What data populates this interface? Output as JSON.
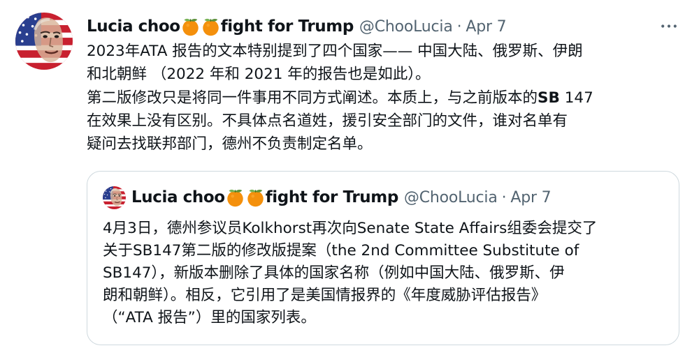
{
  "tweet": {
    "author_name_pre": "Lucia choo",
    "author_name_post": "fight for Trump",
    "handle": "@ChooLucia",
    "separator": "·",
    "date": "Apr 7",
    "body_lines": [
      "2023年ATA 报告的文本特别提到了四个国家—— 中国大陆、俄罗斯、伊朗",
      "和北朝鲜 （2022 年和 2021 年的报告也是如此）。",
      "第二版修改只是将同一件事用不同方式阐述。本质上，与之前版本的",
      "在效果上没有区别。不具体点名道姓，援引安全部门的文件，谁对名单有",
      "疑问去找联邦部门，德州不负责制定名单。"
    ],
    "body_bold": "SB",
    "body_line3_tail": " 147"
  },
  "quoted_tweet": {
    "author_name_pre": "Lucia choo",
    "author_name_post": "fight for Trump",
    "handle": "@ChooLucia",
    "separator": "·",
    "date": "Apr 7",
    "body_lines": [
      "4月3日，德州参议员Kolkhorst再次向Senate State Affairs组委会提交了",
      "关于SB147第二版的修改版提案（the 2nd Committee Substitute of",
      "SB147），新版本删除了具体的国家名称（例如中国大陆、俄罗斯、伊",
      "朗和朝鲜）。相反，它引用了是美国情报界的《年度威胁评估报告》",
      "（“ATA 报告”）里的国家列表。"
    ]
  },
  "icons": {
    "more": "more-options-icon",
    "emoji": "tangerine-emoji-icon",
    "avatar": "flag-portrait-avatar"
  },
  "colors": {
    "text": "#0f1419",
    "secondary": "#536471",
    "border": "#cfd9de",
    "orange": "#f4900c"
  }
}
